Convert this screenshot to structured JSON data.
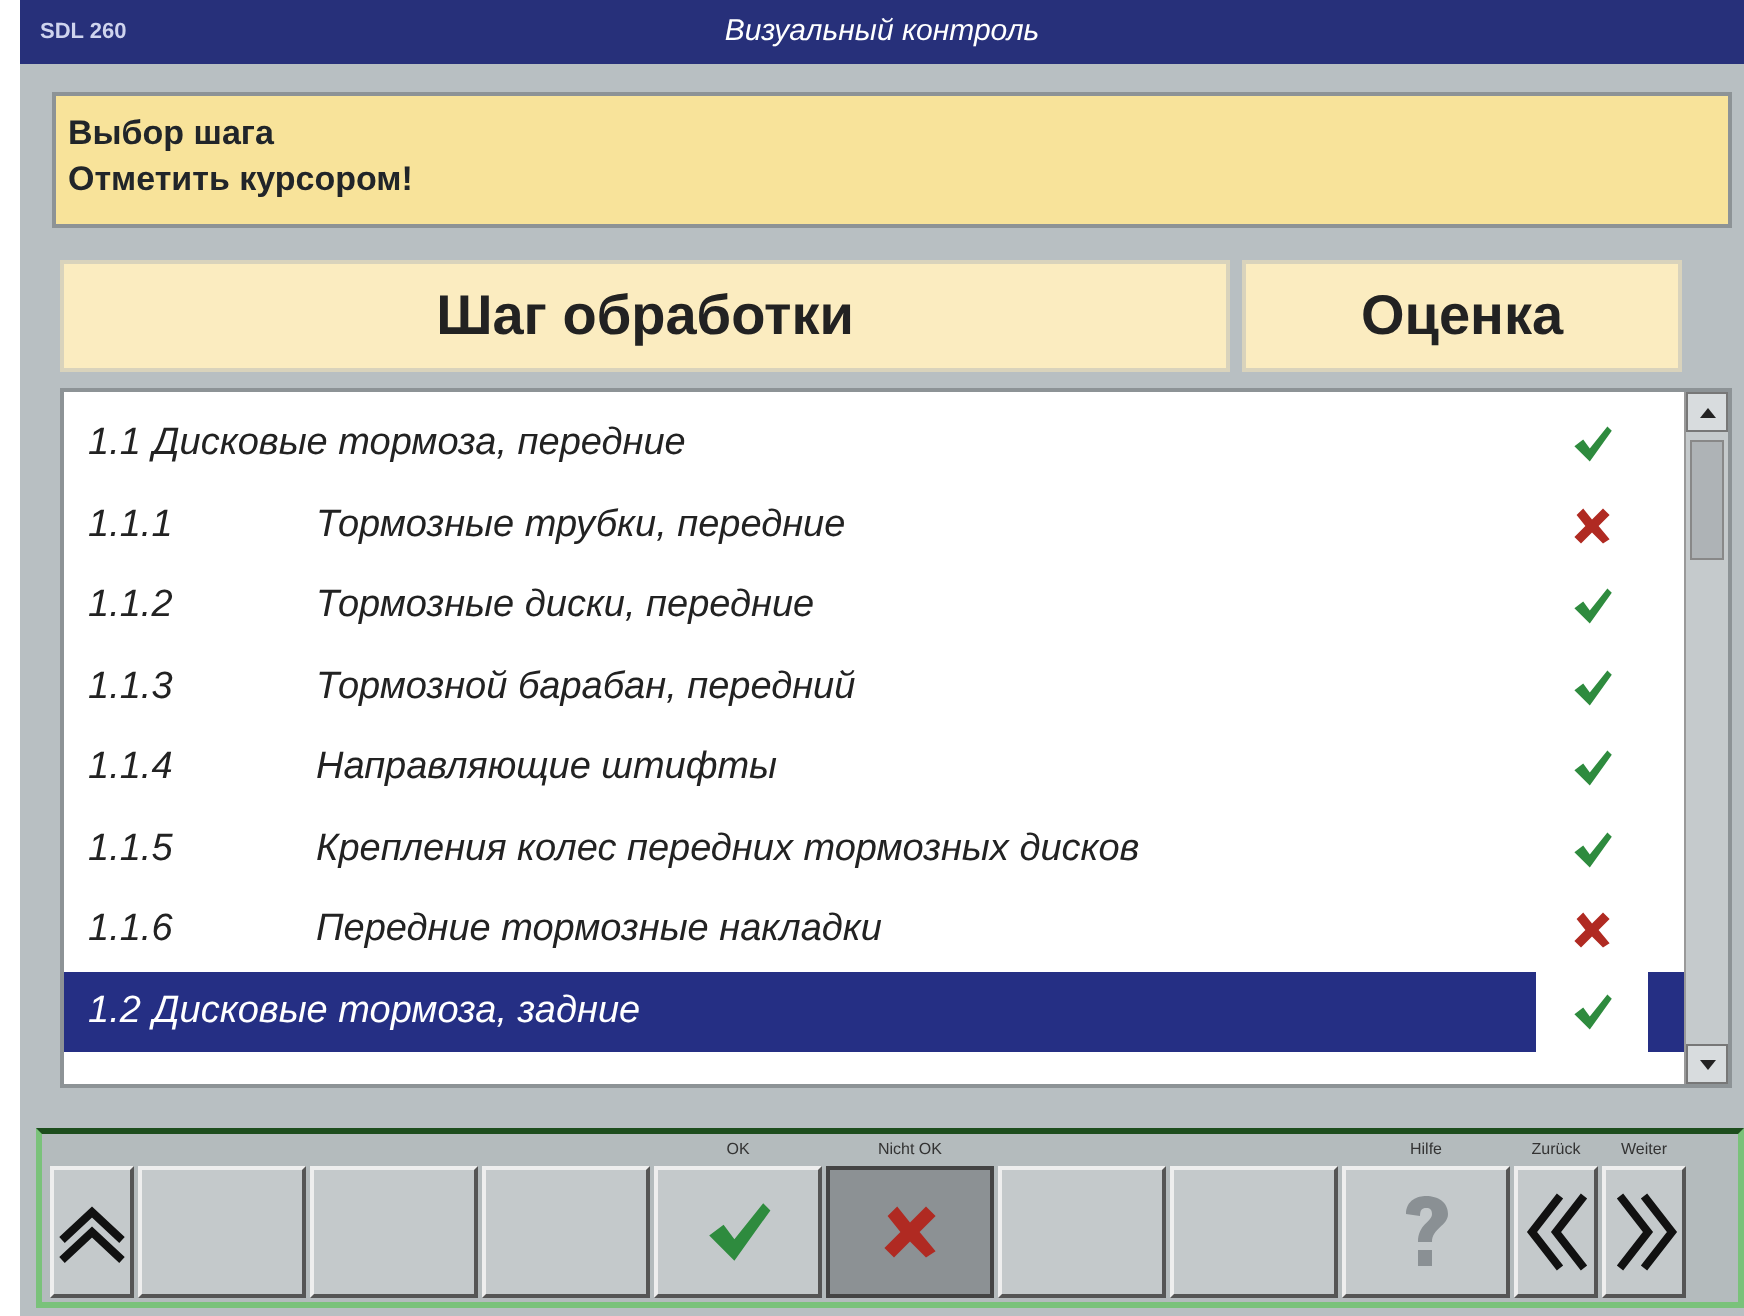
{
  "window": {
    "app": "SDL 260",
    "title": "Визуальный контроль"
  },
  "prompt": [
    "Выбор шага",
    "Отметить курсором!"
  ],
  "columns": [
    "Шаг обработки",
    "Оценка"
  ],
  "steps": [
    {
      "kind": "group",
      "number": "1.1",
      "label": "Дисковые тормоза, передние",
      "passed": true,
      "selected": false
    },
    {
      "kind": "item",
      "number": "1.1.1",
      "label": "Тормозные трубки, передние",
      "passed": false,
      "selected": false
    },
    {
      "kind": "item",
      "number": "1.1.2",
      "label": "Тормозные диски, передние",
      "passed": true,
      "selected": false
    },
    {
      "kind": "item",
      "number": "1.1.3",
      "label": "Тормозной барабан, передний",
      "passed": true,
      "selected": false
    },
    {
      "kind": "item",
      "number": "1.1.4",
      "label": "Направляющие штифты",
      "passed": true,
      "selected": false
    },
    {
      "kind": "item",
      "number": "1.1.5",
      "label": "Крепления колес передних тормозных дисков",
      "passed": true,
      "selected": false
    },
    {
      "kind": "item",
      "number": "1.1.6",
      "label": "Передние тормозные накладки",
      "passed": false,
      "selected": false
    },
    {
      "kind": "group",
      "number": "1.2",
      "label": "Дисковые тормоза, задние",
      "passed": true,
      "selected": true
    }
  ],
  "keys": [
    {
      "kind": "up",
      "pressed": false
    },
    {
      "kind": "blank",
      "pressed": false
    },
    {
      "kind": "blank",
      "pressed": false
    },
    {
      "kind": "blank",
      "pressed": false
    },
    {
      "kind": "ok",
      "caption": "OK",
      "pressed": false
    },
    {
      "kind": "fail",
      "caption": "Nicht OK",
      "pressed": true
    },
    {
      "kind": "blank",
      "pressed": false
    },
    {
      "kind": "blank",
      "pressed": false
    },
    {
      "kind": "help",
      "caption": "Hilfe",
      "pressed": false
    },
    {
      "kind": "back",
      "caption": "Zurück",
      "pressed": false
    },
    {
      "kind": "next",
      "caption": "Weiter",
      "pressed": false
    }
  ]
}
